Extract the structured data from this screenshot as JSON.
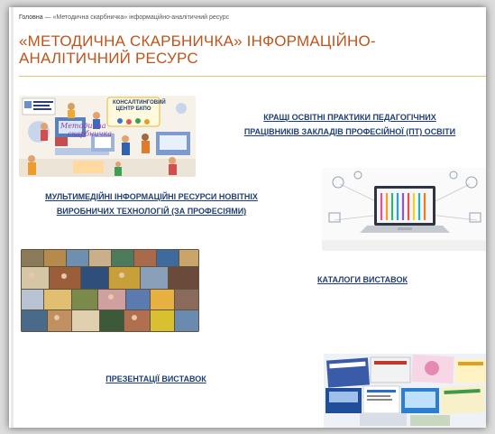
{
  "breadcrumb": {
    "home": "Головна",
    "separator": "—",
    "current": "«Методична скарбничка» інформаційно-аналітичний ресурс"
  },
  "page_title": "«МЕТОДИЧНА СКАРБНИЧКА» ІНФОРМАЦІЙНО-АНАЛІТИЧНИЙ РЕСУРС",
  "thumb1": {
    "caption_top": "КОНСАЛТИНГОВИЙ ЦЕНТР БКПО",
    "caption_main_line1": "Методична",
    "caption_main_line2": "скарбничка"
  },
  "links": {
    "best_practices_line1": "КРАЩІ ОСВІТНІ ПРАКТИКИ ПЕДАГОГІЧНИХ",
    "best_practices_line2": "ПРАЦІВНИКІВ ЗАКЛАДІВ ПРОФЕСІЙНОЇ (ПТ) ОСВІТИ",
    "multimedia_line1": "МУЛЬТИМЕДІЙНІ ІНФОРМАЦІЙНІ РЕСУРСИ НОВІТНІХ",
    "multimedia_line2": "ВИРОБНИЧИХ ТЕХНОЛОГІЙ (ЗА ПРОФЕСІЯМИ)",
    "catalogs": "КАТАЛОГИ ВИСТАВОК",
    "presentations": "ПРЕЗЕНТАЦІЇ ВИСТАВОК"
  },
  "colors": {
    "title": "#c0541a",
    "link": "#1f3f73",
    "rule": "#e2c27a"
  }
}
